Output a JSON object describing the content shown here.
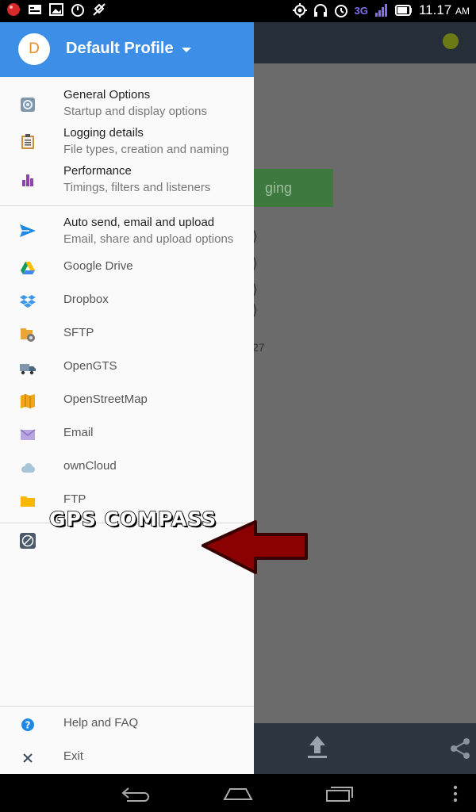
{
  "status_bar": {
    "network": "3G",
    "time": "11.17",
    "ampm": "AM",
    "left_icons": [
      "app-icon",
      "notification-icon",
      "image-icon",
      "timer-icon",
      "gps-off-icon"
    ],
    "right_icons": [
      "location-icon",
      "headset-icon",
      "alarm-icon",
      "signal-icon",
      "battery-icon"
    ]
  },
  "background": {
    "button_text": "ging",
    "side_text": "27"
  },
  "drawer": {
    "header": {
      "avatar_letter": "D",
      "profile_name": "Default Profile"
    },
    "settings": [
      {
        "title": "General Options",
        "subtitle": "Startup and display options",
        "icon": "gear-icon"
      },
      {
        "title": "Logging details",
        "subtitle": "File types, creation and naming",
        "icon": "clipboard-icon"
      },
      {
        "title": "Performance",
        "subtitle": "Timings, filters and listeners",
        "icon": "bar-chart-icon"
      }
    ],
    "upload": {
      "title": "Auto send, email and upload",
      "subtitle": "Email, share and upload options",
      "icon": "send-icon"
    },
    "targets": [
      {
        "label": "Google Drive",
        "icon": "google-drive-icon"
      },
      {
        "label": "Dropbox",
        "icon": "dropbox-icon"
      },
      {
        "label": "SFTP",
        "icon": "sftp-icon"
      },
      {
        "label": "OpenGTS",
        "icon": "truck-icon"
      },
      {
        "label": "OpenStreetMap",
        "icon": "map-icon"
      },
      {
        "label": "Email",
        "icon": "email-icon"
      },
      {
        "label": "ownCloud",
        "icon": "cloud-icon"
      },
      {
        "label": "FTP",
        "icon": "folder-icon"
      }
    ],
    "annotation": {
      "label": "GPS COMPASS",
      "icon": "compass-icon"
    },
    "footer": [
      {
        "label": "Help and FAQ",
        "icon": "help-icon"
      },
      {
        "label": "Exit",
        "icon": "close-icon"
      }
    ]
  },
  "colors": {
    "header_blue": "#3d8ee6",
    "avatar_orange": "#f08a23",
    "arrow_red": "#8b0000"
  }
}
